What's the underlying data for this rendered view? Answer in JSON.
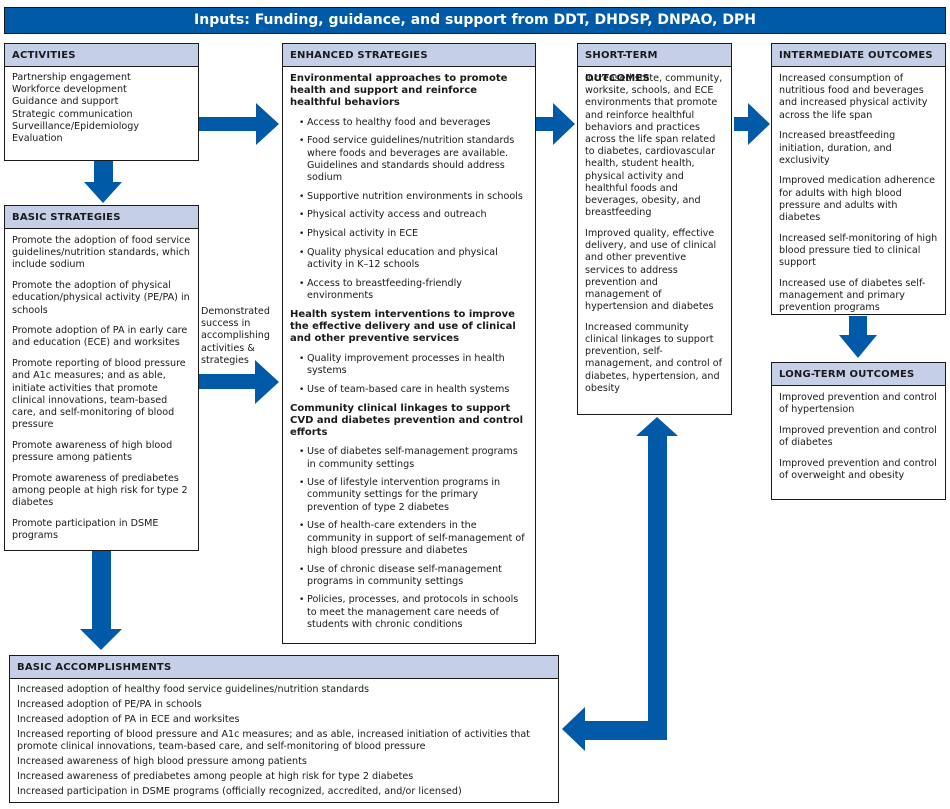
{
  "banner": {
    "title": "Inputs: Funding, guidance, and support from DDT, DHDSP, DNPAO, DPH"
  },
  "colors": {
    "accent": "#005aa7",
    "header_fill": "#c5d0e8",
    "border": "#1a1a1a"
  },
  "activities": {
    "title": "ACTIVITIES",
    "items": [
      "Partnership engagement",
      "Workforce development",
      "Guidance and support",
      "Strategic communication",
      "Surveillance/Epidemiology",
      "Evaluation"
    ]
  },
  "basic_strategies": {
    "title": "BASIC STRATEGIES",
    "items": [
      "Promote the adoption of food service guidelines/nutrition standards, which include sodium",
      "Promote the adoption of physical education/physical activity (PE/PA) in schools",
      "Promote adoption of PA in early care and education (ECE) and worksites",
      "Promote reporting of blood pressure and A1c measures; and as able, initiate activities that promote clinical innovations, team-based care, and self-monitoring of blood pressure",
      "Promote awareness of high blood pressure among patients",
      "Promote awareness of prediabetes among people at high risk for type 2 diabetes",
      "Promote participation in DSME programs"
    ]
  },
  "transition_note": "Demonstrated success in accomplishing activities & strategies",
  "enhanced_strategies": {
    "title": "ENHANCED STRATEGIES",
    "sections": [
      {
        "heading": "Environmental approaches to promote health and support and reinforce healthful behaviors",
        "bullets": [
          "Access to healthy food and beverages",
          "Food service guidelines/nutrition standards where foods and beverages are available. Guidelines and standards should address sodium",
          "Supportive nutrition environments in schools",
          "Physical activity access and outreach",
          "Physical activity in ECE",
          "Quality physical education and physical activity in K–12 schools",
          "Access to breastfeeding-friendly environments"
        ]
      },
      {
        "heading": "Health system interventions to improve the effective delivery and use of clinical and other preventive services",
        "bullets": [
          "Quality improvement processes in health systems",
          "Use of team-based care in health systems"
        ]
      },
      {
        "heading": "Community clinical linkages to support CVD and diabetes prevention and control efforts",
        "bullets": [
          "Use of diabetes self-management programs in community settings",
          "Use of lifestyle intervention programs in community settings for the primary prevention of type 2 diabetes",
          "Use of health-care extenders in the community in support of self-management of high blood pressure and diabetes",
          "Use of chronic disease self-management programs in community settings",
          "Policies, processes, and protocols in schools to meet the management care needs of students with chronic conditions"
        ]
      }
    ]
  },
  "short_term_outcomes": {
    "title": "SHORT-TERM OUTCOMES",
    "items": [
      "Increased state, community, worksite, schools, and ECE environments that promote and reinforce healthful behaviors and practices across the life span related to diabetes, cardiovascular health, student health, physical activity and healthful foods and beverages, obesity, and breastfeeding",
      "Improved quality, effective delivery, and use of clinical and other preventive services to address prevention and management of hypertension and diabetes",
      "Increased community clinical linkages to support prevention, self-management, and control of diabetes, hypertension, and obesity"
    ]
  },
  "intermediate_outcomes": {
    "title": "INTERMEDIATE OUTCOMES",
    "items": [
      "Increased consumption of nutritious food and beverages and increased physical activity across the life span",
      "Increased breastfeeding initiation, duration, and exclusivity",
      "Improved medication adherence for adults with high blood pressure and adults with diabetes",
      "Increased self-monitoring of high blood pressure tied to clinical support",
      "Increased use of diabetes self-management and primary prevention programs"
    ]
  },
  "long_term_outcomes": {
    "title": "LONG-TERM OUTCOMES",
    "items": [
      "Improved prevention and control of hypertension",
      "Improved prevention and control of diabetes",
      "Improved prevention and control of overweight and obesity"
    ]
  },
  "basic_accomplishments": {
    "title": "BASIC ACCOMPLISHMENTS",
    "items": [
      "Increased adoption of healthy food service guidelines/nutrition standards",
      "Increased adoption of PE/PA in schools",
      "Increased adoption of PA in ECE and worksites",
      "Increased reporting of blood pressure and A1c measures; and as able, increased initiation of activities that promote clinical innovations, team-based care, and self-monitoring of blood pressure",
      "Increased awareness of high blood pressure among patients",
      "Increased awareness of prediabetes among people at high risk for type 2 diabetes",
      "Increased participation in DSME programs (officially recognized, accredited, and/or licensed)"
    ]
  }
}
